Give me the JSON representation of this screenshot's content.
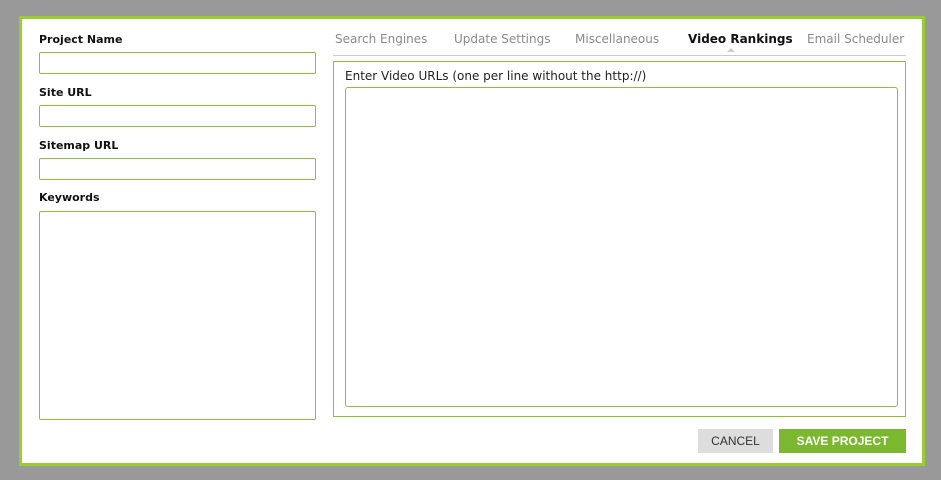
{
  "form": {
    "project_name_label": "Project Name",
    "project_name_value": "",
    "site_url_label": "Site URL",
    "site_url_value": "",
    "sitemap_url_label": "Sitemap URL",
    "sitemap_url_value": "",
    "keywords_label": "Keywords",
    "keywords_value": ""
  },
  "tabs": [
    {
      "label": "Search Engines",
      "active": false
    },
    {
      "label": "Update Settings",
      "active": false
    },
    {
      "label": "Miscellaneous",
      "active": false
    },
    {
      "label": "Video Rankings",
      "active": true
    },
    {
      "label": "Email Scheduler",
      "active": false
    }
  ],
  "panel": {
    "label": "Enter Video URLs (one per line without the http://)",
    "value": ""
  },
  "buttons": {
    "cancel_label": "CANCEL",
    "save_label": "SAVE PROJECT"
  },
  "colors": {
    "accent": "#9acd32",
    "save_button": "#7cb82f",
    "cancel_button": "#dddddd",
    "backdrop": "#999999"
  }
}
